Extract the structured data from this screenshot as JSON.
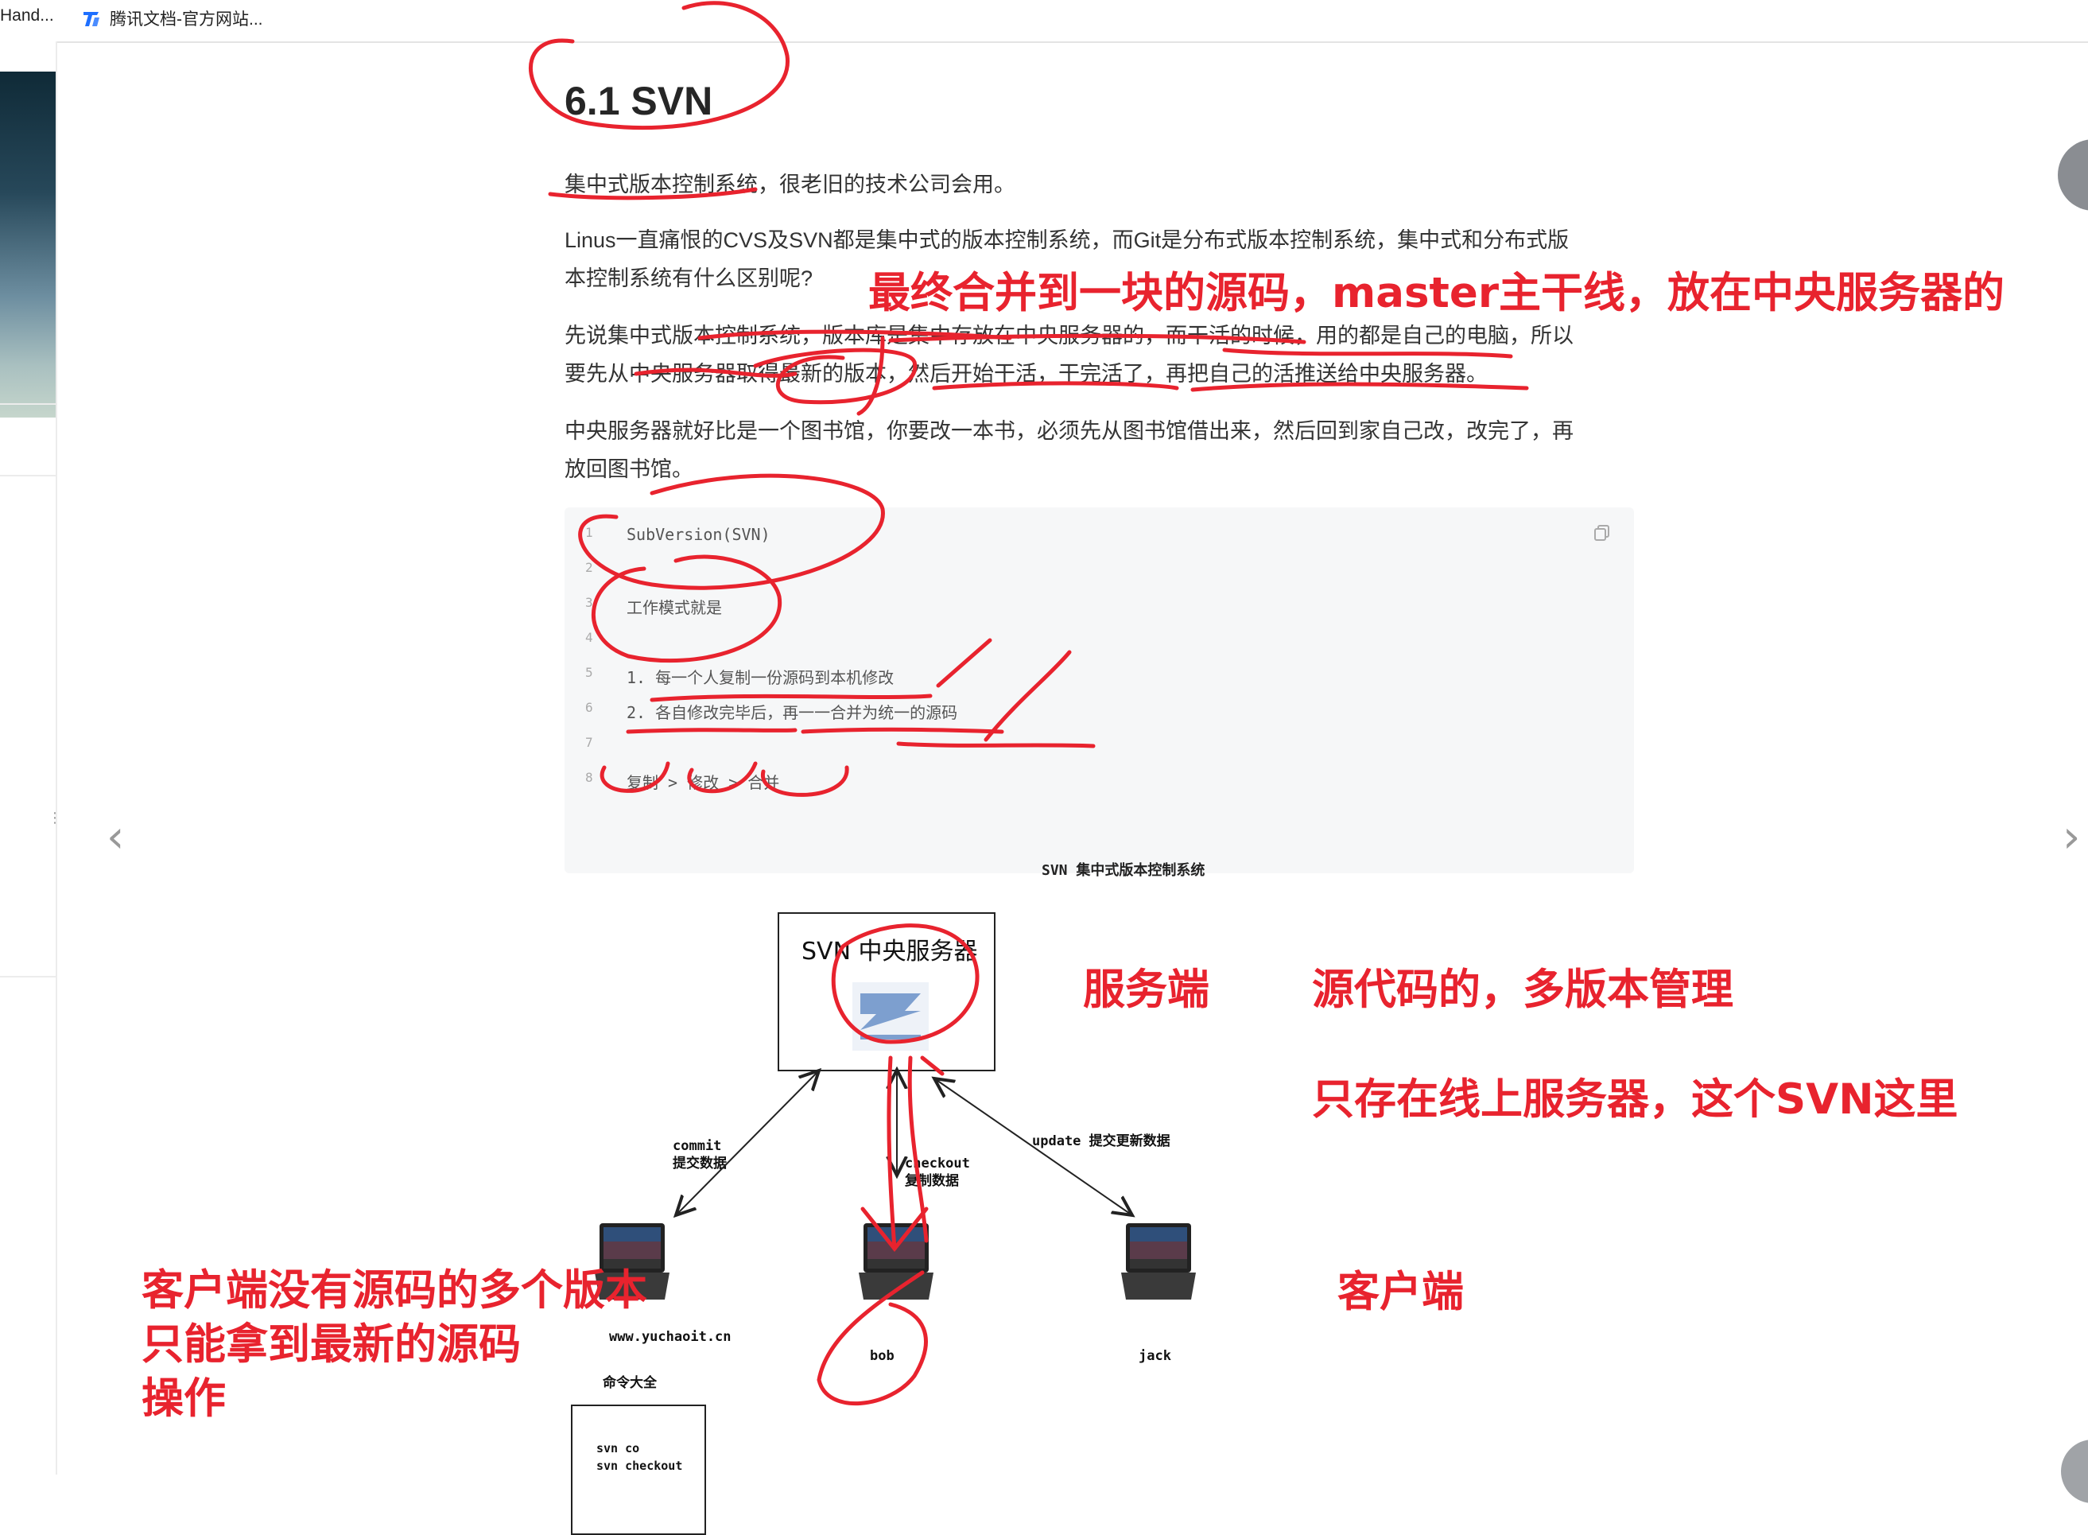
{
  "bookmarks": [
    {
      "label": "Hand...",
      "icon": "none"
    },
    {
      "label": "腾讯文档-官方网站...",
      "icon": "tencent-docs-icon"
    }
  ],
  "article": {
    "heading": "6.1 SVN",
    "p1": "集中式版本控制系统，很老旧的技术公司会用。",
    "p2_line1": "Linus一直痛恨的CVS及SVN都是集中式的版本控制系统，而Git是分布式版本控制系统，集中式和分布式版",
    "p2_line2": "本控制系统有什么区别呢?",
    "p3_line1": "先说集中式版本控制系统，版本库是集中存放在中央服务器的，而干活的时候，用的都是自己的电脑，所以",
    "p3_line2": "要先从中央服务器取得最新的版本，然后开始干活，干完活了，再把自己的活推送给中央服务器。",
    "p4_line1": "中央服务器就好比是一个图书馆，你要改一本书，必须先从图书馆借出来，然后回到家自己改，改完了，再",
    "p4_line2": "放回图书馆。"
  },
  "code_block": {
    "lines": [
      {
        "no": "1",
        "text": "SubVersion(SVN)"
      },
      {
        "no": "2",
        "text": ""
      },
      {
        "no": "3",
        "text": "工作模式就是"
      },
      {
        "no": "4",
        "text": ""
      },
      {
        "no": "5",
        "text": "1. 每一个人复制一份源码到本机修改"
      },
      {
        "no": "6",
        "text": "2. 各自修改完毕后，再一一合并为统一的源码"
      },
      {
        "no": "7",
        "text": ""
      },
      {
        "no": "8",
        "text": "复制 > 修改 > 合并"
      }
    ]
  },
  "diagram": {
    "title": "SVN 集中式版本控制系统",
    "server_label": "SVN 中央服务器",
    "commit_label": "commit",
    "commit_sub": "提交数据",
    "checkout_label": "checkout",
    "checkout_sub": "复制数据",
    "update_label": "update 提交更新数据",
    "client_left": "www.yuchaoit.cn",
    "client_mid": "bob",
    "client_right": "jack",
    "cmd_title": "命令大全",
    "cmd_line1": "svn co",
    "cmd_line2": "svn checkout"
  },
  "annotations": {
    "master": "最终合并到一块的源码，master主干线，放在中央服务器的",
    "server_side": "服务端",
    "multi_version": "源代码的，多版本管理",
    "online_only": "只存在线上服务器，这个SVN这里",
    "client_side": "客户端",
    "client_note1": "客户端没有源码的多个版本",
    "client_note2": "只能拿到最新的源码",
    "client_note3": "操作"
  },
  "colors": {
    "annotation_red": "#e8232e",
    "code_bg": "#f6f7f8",
    "tencent_blue": "#1e6fff"
  }
}
